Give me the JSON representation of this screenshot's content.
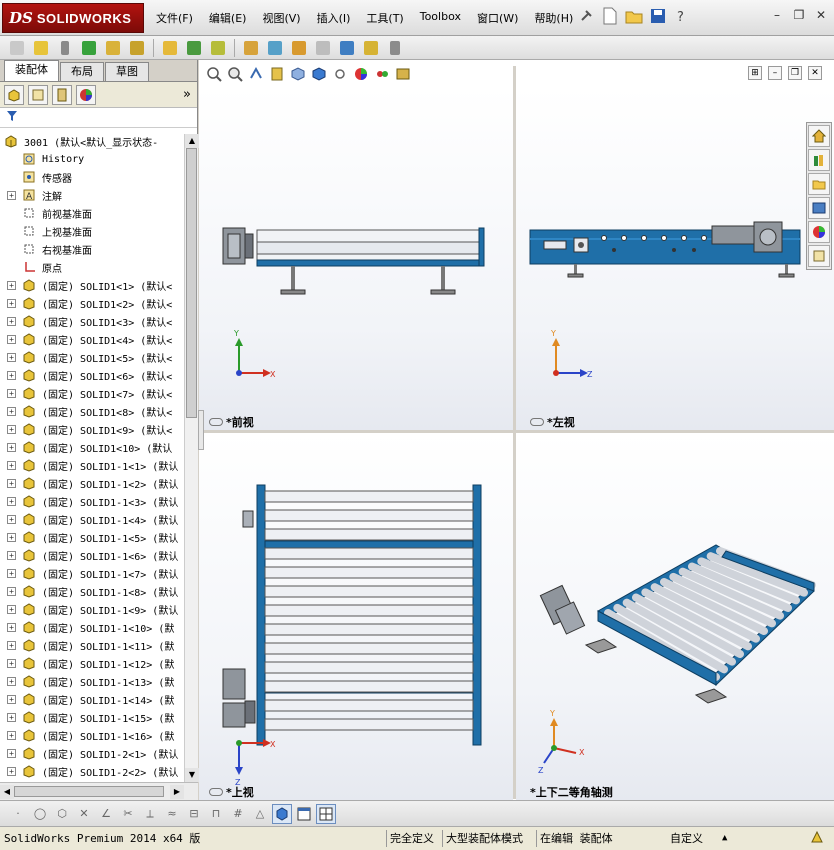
{
  "app": {
    "logo_ds": "DS",
    "logo_name": "SOLIDWORKS"
  },
  "menu": [
    "文件(F)",
    "编辑(E)",
    "视图(V)",
    "插入(I)",
    "工具(T)",
    "Toolbox",
    "窗口(W)",
    "帮助(H)"
  ],
  "feature_manager": {
    "tabs": [
      "装配体",
      "布局",
      "草图"
    ],
    "active_tab": "装配体",
    "tree": [
      {
        "label": "3001  (默认<默认_显示状态-",
        "icon": "assembly-icon",
        "expand": false,
        "level": 0
      },
      {
        "label": "History",
        "icon": "history-icon",
        "expand": false,
        "level": 1
      },
      {
        "label": "传感器",
        "icon": "sensor-icon",
        "expand": false,
        "level": 1
      },
      {
        "label": "注解",
        "icon": "annotation-icon",
        "expand": true,
        "level": 1
      },
      {
        "label": "前视基准面",
        "icon": "plane-icon",
        "expand": false,
        "level": 1
      },
      {
        "label": "上视基准面",
        "icon": "plane-icon",
        "expand": false,
        "level": 1
      },
      {
        "label": "右视基准面",
        "icon": "plane-icon",
        "expand": false,
        "level": 1
      },
      {
        "label": "原点",
        "icon": "origin-icon",
        "expand": false,
        "level": 1
      },
      {
        "label": "(固定) SOLID1<1> (默认<",
        "icon": "part-icon",
        "expand": true,
        "level": 1
      },
      {
        "label": "(固定) SOLID1<2> (默认<",
        "icon": "part-icon",
        "expand": true,
        "level": 1
      },
      {
        "label": "(固定) SOLID1<3> (默认<",
        "icon": "part-icon",
        "expand": true,
        "level": 1
      },
      {
        "label": "(固定) SOLID1<4> (默认<",
        "icon": "part-icon",
        "expand": true,
        "level": 1
      },
      {
        "label": "(固定) SOLID1<5> (默认<",
        "icon": "part-icon",
        "expand": true,
        "level": 1
      },
      {
        "label": "(固定) SOLID1<6> (默认<",
        "icon": "part-icon",
        "expand": true,
        "level": 1
      },
      {
        "label": "(固定) SOLID1<7> (默认<",
        "icon": "part-icon",
        "expand": true,
        "level": 1
      },
      {
        "label": "(固定) SOLID1<8> (默认<",
        "icon": "part-icon",
        "expand": true,
        "level": 1
      },
      {
        "label": "(固定) SOLID1<9> (默认<",
        "icon": "part-icon",
        "expand": true,
        "level": 1
      },
      {
        "label": "(固定) SOLID1<10> (默认",
        "icon": "part-icon",
        "expand": true,
        "level": 1
      },
      {
        "label": "(固定) SOLID1-1<1> (默认",
        "icon": "part-icon",
        "expand": true,
        "level": 1
      },
      {
        "label": "(固定) SOLID1-1<2> (默认",
        "icon": "part-icon",
        "expand": true,
        "level": 1
      },
      {
        "label": "(固定) SOLID1-1<3> (默认",
        "icon": "part-icon",
        "expand": true,
        "level": 1
      },
      {
        "label": "(固定) SOLID1-1<4> (默认",
        "icon": "part-icon",
        "expand": true,
        "level": 1
      },
      {
        "label": "(固定) SOLID1-1<5> (默认",
        "icon": "part-icon",
        "expand": true,
        "level": 1
      },
      {
        "label": "(固定) SOLID1-1<6> (默认",
        "icon": "part-icon",
        "expand": true,
        "level": 1
      },
      {
        "label": "(固定) SOLID1-1<7> (默认",
        "icon": "part-icon",
        "expand": true,
        "level": 1
      },
      {
        "label": "(固定) SOLID1-1<8> (默认",
        "icon": "part-icon",
        "expand": true,
        "level": 1
      },
      {
        "label": "(固定) SOLID1-1<9> (默认",
        "icon": "part-icon",
        "expand": true,
        "level": 1
      },
      {
        "label": "(固定) SOLID1-1<10> (默",
        "icon": "part-icon",
        "expand": true,
        "level": 1
      },
      {
        "label": "(固定) SOLID1-1<11> (默",
        "icon": "part-icon",
        "expand": true,
        "level": 1
      },
      {
        "label": "(固定) SOLID1-1<12> (默",
        "icon": "part-icon",
        "expand": true,
        "level": 1
      },
      {
        "label": "(固定) SOLID1-1<13> (默",
        "icon": "part-icon",
        "expand": true,
        "level": 1
      },
      {
        "label": "(固定) SOLID1-1<14> (默",
        "icon": "part-icon",
        "expand": true,
        "level": 1
      },
      {
        "label": "(固定) SOLID1-1<15> (默",
        "icon": "part-icon",
        "expand": true,
        "level": 1
      },
      {
        "label": "(固定) SOLID1-1<16> (默",
        "icon": "part-icon",
        "expand": true,
        "level": 1
      },
      {
        "label": "(固定) SOLID1-2<1> (默认",
        "icon": "part-icon",
        "expand": true,
        "level": 1
      },
      {
        "label": "(固定) SOLID1-2<2> (默认",
        "icon": "part-icon",
        "expand": true,
        "level": 1
      }
    ]
  },
  "viewports": {
    "front": {
      "name": "*前视",
      "axes": [
        "Y",
        "X"
      ]
    },
    "left": {
      "name": "*左视",
      "axes": [
        "Y",
        "Z"
      ]
    },
    "top": {
      "name": "*上视",
      "axes": [
        "X",
        "Z"
      ]
    },
    "iso": {
      "name": "*上下二等角轴测",
      "axes": [
        "Y",
        "X",
        "Z"
      ]
    }
  },
  "status_bar": {
    "product": "SolidWorks Premium 2014 x64 版",
    "definition": "完全定义",
    "mode": "大型装配体模式",
    "editing": "在编辑 装配体",
    "units": "自定义",
    "units_arrow": "▲"
  },
  "colors": {
    "frame_blue": "#1f6fa8",
    "roller": "#e8ebf0",
    "motor": "#9aa0a8",
    "x_axis": "#d03020",
    "y_axis": "#2a9a2a",
    "z_axis": "#2a44c8"
  }
}
